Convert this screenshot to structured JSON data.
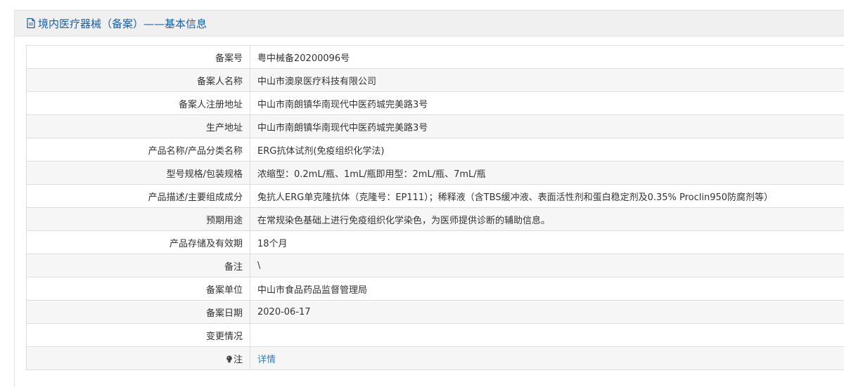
{
  "header": {
    "title": "境内医疗器械（备案）——基本信息"
  },
  "rows": [
    {
      "label": "备案号",
      "value": "粤中械备20200096号"
    },
    {
      "label": "备案人名称",
      "value": "中山市澳泉医疗科技有限公司"
    },
    {
      "label": "备案人注册地址",
      "value": "中山市南朗镇华南现代中医药城完美路3号"
    },
    {
      "label": "生产地址",
      "value": "中山市南朗镇华南现代中医药城完美路3号"
    },
    {
      "label": "产品名称/产品分类名称",
      "value": "ERG抗体试剂(免疫组织化学法)"
    },
    {
      "label": "型号规格/包装规格",
      "value": "浓缩型：0.2mL/瓶、1mL/瓶即用型：2mL/瓶、7mL/瓶"
    },
    {
      "label": "产品描述/主要组成成分",
      "value": "兔抗人ERG单克隆抗体（克隆号：EP111）；稀释液（含TBS缓冲液、表面活性剂和蛋白稳定剂及0.35% Proclin950防腐剂等）"
    },
    {
      "label": "预期用途",
      "value": "在常规染色基础上进行免疫组织化学染色，为医师提供诊断的辅助信息。"
    },
    {
      "label": "产品存储及有效期",
      "value": "18个月"
    },
    {
      "label": "备注",
      "value": "\\"
    },
    {
      "label": "备案单位",
      "value": "中山市食品药品监督管理局"
    },
    {
      "label": "备案日期",
      "value": "2020-06-17"
    },
    {
      "label": "变更情况",
      "value": ""
    }
  ],
  "note_row": {
    "label": "注",
    "icon": "bulb-icon",
    "link_label": "详情"
  },
  "colors": {
    "title": "#1c5ea8",
    "link": "#2b7bd0",
    "row_alt": "#f6f6f6",
    "header_bg": "#f0f0f0"
  }
}
